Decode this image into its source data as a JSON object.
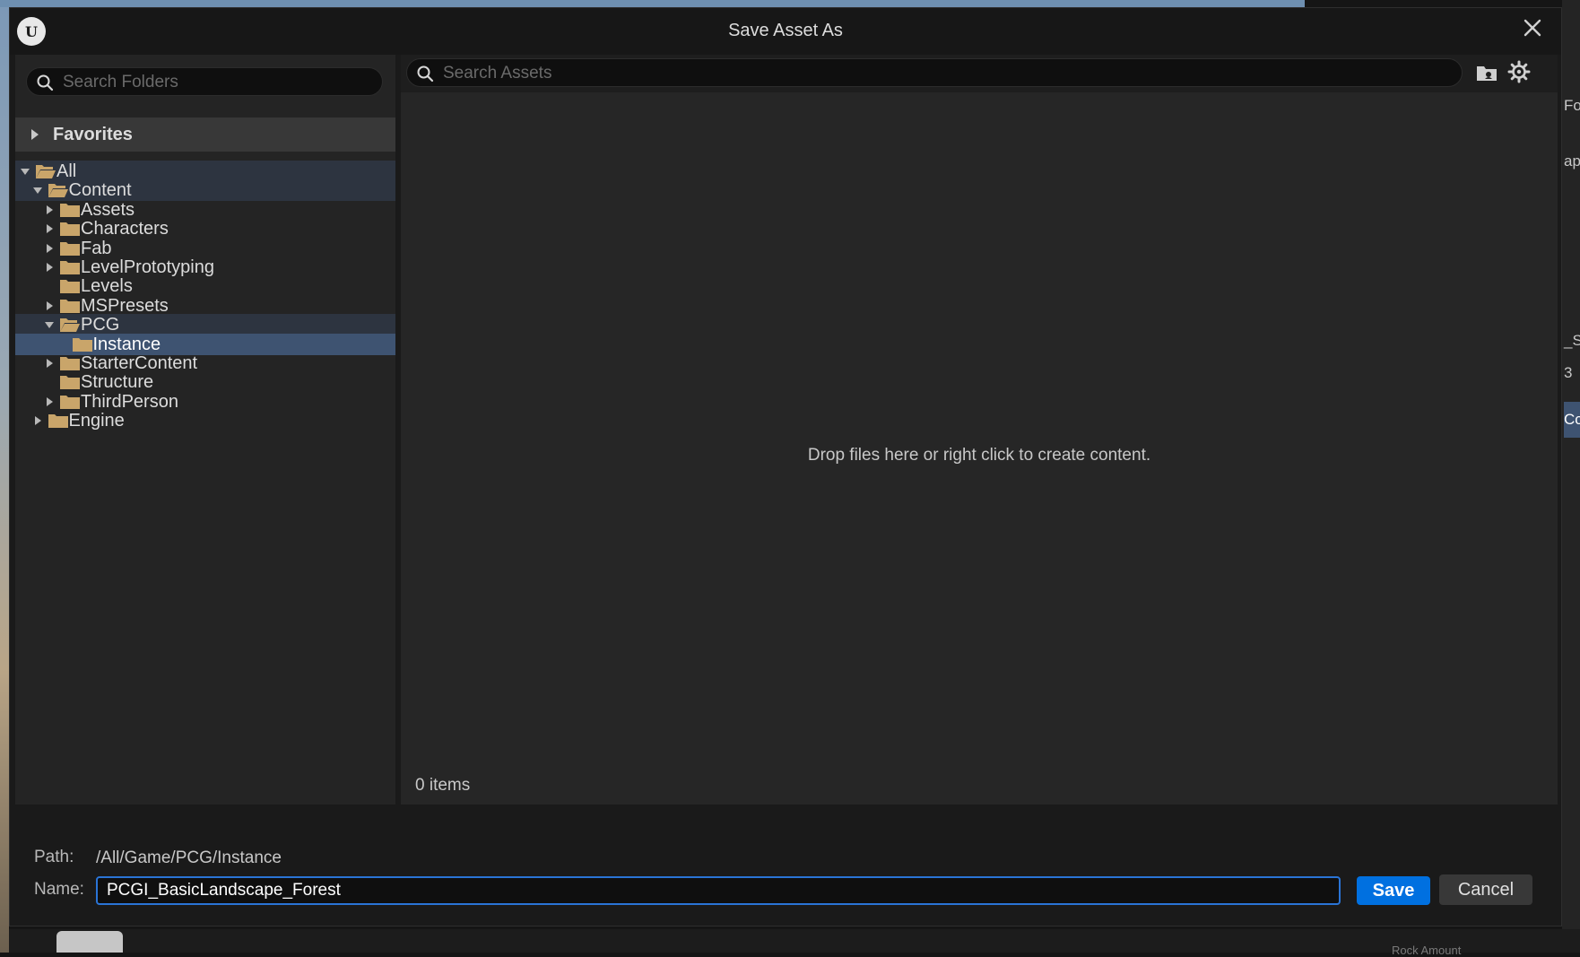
{
  "dialog": {
    "title": "Save Asset As",
    "logo_text": "U",
    "close_icon": "close-icon"
  },
  "folders": {
    "search_placeholder": "Search Folders",
    "favorites_label": "Favorites",
    "tree": [
      {
        "label": "All",
        "depth": 0,
        "caret": "down",
        "state": "highlighted"
      },
      {
        "label": "Content",
        "depth": 1,
        "caret": "down",
        "state": "highlighted"
      },
      {
        "label": "Assets",
        "depth": 2,
        "caret": "right",
        "state": ""
      },
      {
        "label": "Characters",
        "depth": 2,
        "caret": "right",
        "state": ""
      },
      {
        "label": "Fab",
        "depth": 2,
        "caret": "right",
        "state": ""
      },
      {
        "label": "LevelPrototyping",
        "depth": 2,
        "caret": "right",
        "state": ""
      },
      {
        "label": "Levels",
        "depth": 2,
        "caret": "none",
        "state": ""
      },
      {
        "label": "MSPresets",
        "depth": 2,
        "caret": "right",
        "state": ""
      },
      {
        "label": "PCG",
        "depth": 2,
        "caret": "down",
        "state": "highlighted"
      },
      {
        "label": "Instance",
        "depth": 3,
        "caret": "none",
        "state": "selected"
      },
      {
        "label": "StarterContent",
        "depth": 2,
        "caret": "right",
        "state": ""
      },
      {
        "label": "Structure",
        "depth": 2,
        "caret": "none",
        "state": ""
      },
      {
        "label": "ThirdPerson",
        "depth": 2,
        "caret": "right",
        "state": ""
      },
      {
        "label": "Engine",
        "depth": 1,
        "caret": "right",
        "state": ""
      }
    ]
  },
  "assets": {
    "search_placeholder": "Search Assets",
    "empty_message": "Drop files here or right click to create content.",
    "items_count": "0 items"
  },
  "footer": {
    "path_label": "Path:",
    "path_value": "/All/Game/PCG/Instance",
    "name_label": "Name:",
    "name_value": "PCGI_BasicLandscape_Forest",
    "save_label": "Save",
    "cancel_label": "Cancel"
  },
  "background": {
    "right_labels": [
      "Fo",
      "ap",
      "_S",
      "3",
      "Cc"
    ],
    "bottom_label": "Rock Amount"
  },
  "colors": {
    "accent": "#0070e0",
    "selection": "#3e5371",
    "folder": "#c9a56a"
  }
}
